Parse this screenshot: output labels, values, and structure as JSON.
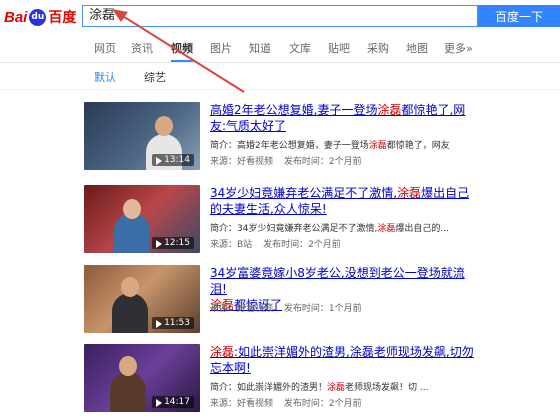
{
  "logo": {
    "latin": "Bai",
    "paw": "du",
    "cn": "百度"
  },
  "search": {
    "query": "涂磊",
    "button_label": "百度一下"
  },
  "tabs": [
    "网页",
    "资讯",
    "视频",
    "图片",
    "知道",
    "文库",
    "贴吧",
    "采购",
    "地图",
    "更多»"
  ],
  "active_tab_index": 2,
  "filters": [
    "默认",
    "综艺"
  ],
  "results": [
    {
      "title_before": "高婚2年老公想复婚,妻子一登场",
      "title_hl": "涂磊",
      "title_after": "都惊艳了,网友:气质太好了",
      "snippet_before": "简介：高婚2年老公想复婚，妻子一登场",
      "snippet_hl": "涂磊",
      "snippet_after": "都惊艳了，网友",
      "source": "来源：好看视频",
      "time": "发布时间：2个月前",
      "duration": "13:14"
    },
    {
      "title_before": "34岁少妇竟嫌弃老公满足不了激情,",
      "title_hl": "涂磊",
      "title_after": "爆出自己的夫妻生活,众人惊呆!",
      "snippet_before": "简介：34岁少妇竟嫌弃老公满足不了激情,",
      "snippet_hl": "涂磊",
      "snippet_after": "爆出自己的...",
      "source": "来源：B站",
      "time": "发布时间：2个月前",
      "duration": "12:15"
    },
    {
      "title_before": "34岁富婆竟嫁小8岁老公,没想到老公一登场就流泪!",
      "title_hl": "涂磊",
      "title_after": "都惊讶了",
      "snippet_before": "",
      "snippet_hl": "",
      "snippet_after": "",
      "source": "来源：好看视频",
      "time": "发布时间：1个月前",
      "duration": "11:53"
    },
    {
      "title_before": "",
      "title_hl": "涂磊",
      "title_after": ":如此崇洋媚外的渣男,涂磊老师现场发飙,切勿忘本啊!",
      "snippet_before": "简介：如此崇洋媚外的渣男！",
      "snippet_hl": "涂磊",
      "snippet_after": "老师现场发飙！切 ...",
      "source": "来源：好看视频",
      "time": "发布时间：2个月前",
      "duration": "14:17"
    }
  ],
  "colors": {
    "accent": "#3385ff",
    "link": "#0000cc",
    "highlight": "#cc0000",
    "arrow": "#d9463c"
  }
}
